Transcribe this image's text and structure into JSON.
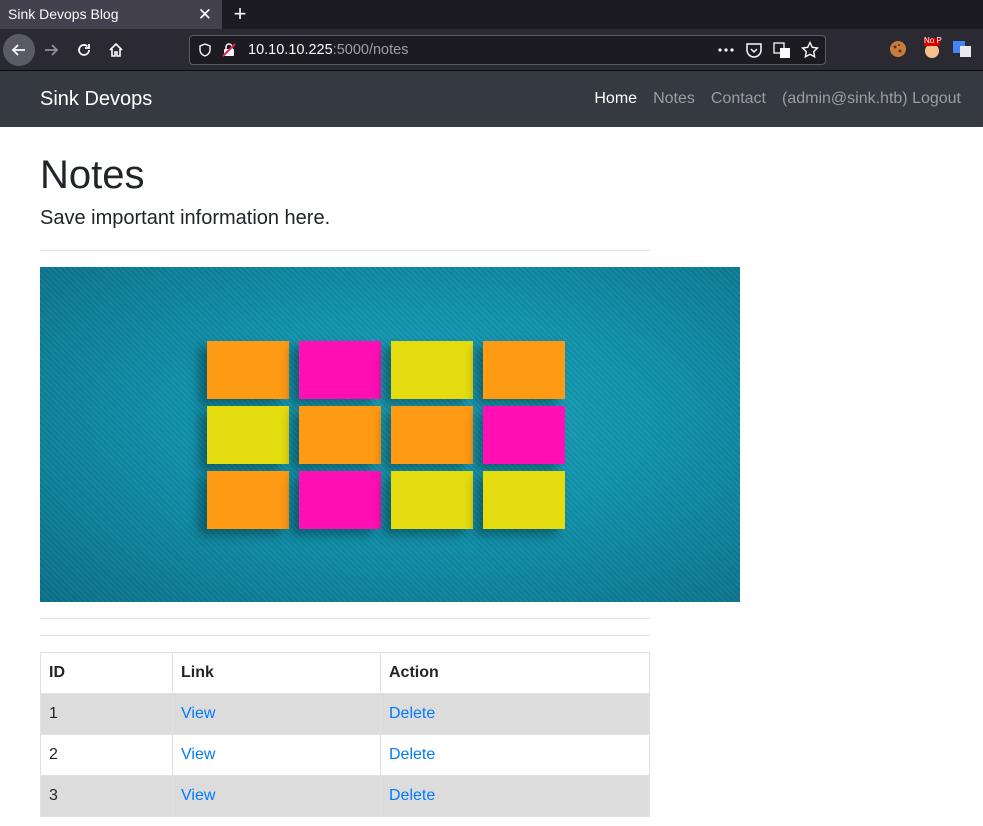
{
  "browser": {
    "tab_title": "Sink Devops Blog",
    "close_glyph": "✕",
    "newtab_glyph": "+",
    "url_host": "10.10.10.225",
    "url_rest": ":5000/notes",
    "nop_badge": "No P"
  },
  "site": {
    "brand": "Sink Devops",
    "nav": {
      "home": "Home",
      "notes": "Notes",
      "contact": "Contact",
      "logout": "(admin@sink.htb) Logout"
    }
  },
  "page": {
    "title": "Notes",
    "lead": "Save important information here."
  },
  "hero_notes": [
    [
      "orange",
      "pink",
      "yellow",
      "orange"
    ],
    [
      "yellow",
      "orange",
      "orange",
      "pink"
    ],
    [
      "orange",
      "pink",
      "yellow",
      "yellow"
    ]
  ],
  "table": {
    "headers": [
      "ID",
      "Link",
      "Action"
    ],
    "rows": [
      {
        "id": "1",
        "link": "View",
        "action": "Delete"
      },
      {
        "id": "2",
        "link": "View",
        "action": "Delete"
      },
      {
        "id": "3",
        "link": "View",
        "action": "Delete"
      }
    ]
  },
  "colors": {
    "navbar": "#343a40",
    "link": "#007bff",
    "note_orange": "#ff9a14",
    "note_pink": "#ff0fb4",
    "note_yellow": "#e5dc10"
  }
}
